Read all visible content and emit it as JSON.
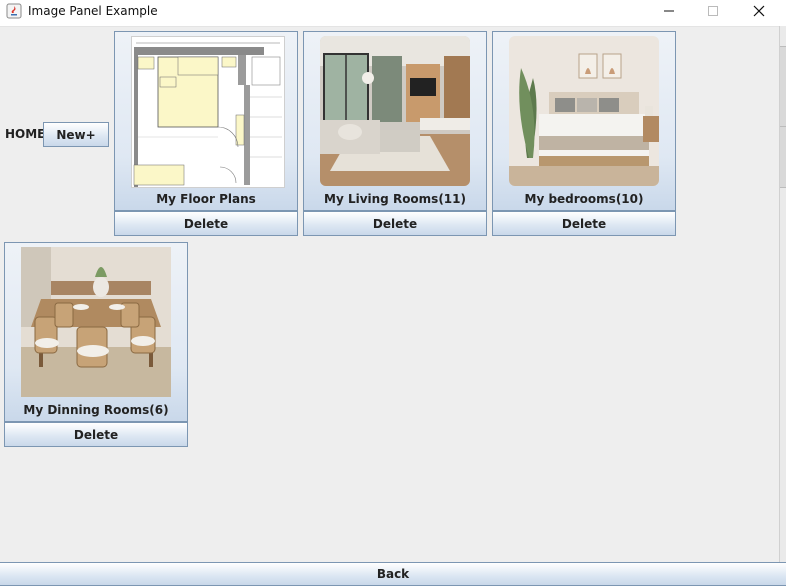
{
  "window": {
    "title": "Image Panel Example"
  },
  "nav": {
    "home_label": "HOME",
    "new_button": "New+"
  },
  "cards": [
    {
      "label": "My Floor Plans",
      "delete_label": "Delete",
      "image": "floor-plan-image"
    },
    {
      "label": "My Living Rooms(11)",
      "delete_label": "Delete",
      "image": "living-room-image"
    },
    {
      "label": "My bedrooms(10)",
      "delete_label": "Delete",
      "image": "bedroom-image"
    },
    {
      "label": "My Dinning Rooms(6)",
      "delete_label": "Delete",
      "image": "dining-room-image"
    }
  ],
  "footer": {
    "back_button": "Back"
  },
  "colors": {
    "button_border": "#7c96b2",
    "button_gradient_top": "#ffffff",
    "button_gradient_bottom": "#c9d8ea",
    "background": "#eeeeee"
  }
}
